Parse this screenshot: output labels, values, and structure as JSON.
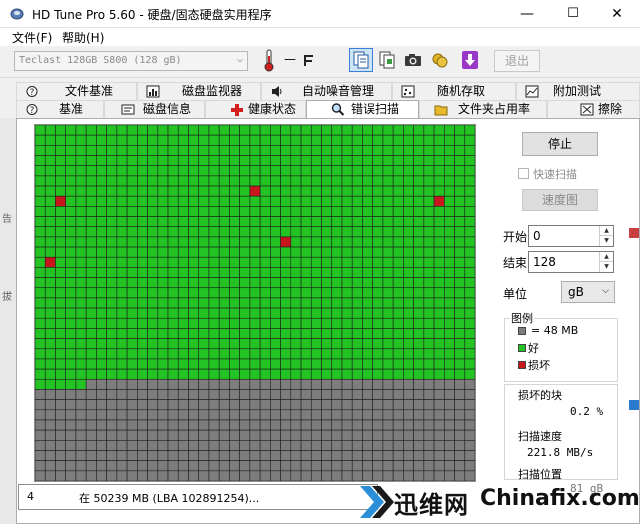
{
  "window": {
    "title": "HD Tune Pro 5.60 - 硬盘/固态硬盘实用程序",
    "controls": {
      "minimize": "—",
      "maximize": "☐",
      "close": "✕"
    }
  },
  "menu": {
    "file": "文件(F)",
    "help": "帮助(H)"
  },
  "toolbar": {
    "drive": "Teclast 128GB S800 (128 gB)",
    "temperature": "—",
    "exit_label": "退出"
  },
  "tabs_top": [
    {
      "label": "文件基准",
      "icon": "file-benchmark-icon"
    },
    {
      "label": "磁盘监视器",
      "icon": "disk-monitor-icon"
    },
    {
      "label": "自动噪音管理",
      "icon": "speaker-icon"
    },
    {
      "label": "随机存取",
      "icon": "random-access-icon"
    },
    {
      "label": "附加测试",
      "icon": "extra-tests-icon"
    }
  ],
  "tabs_bottom": [
    {
      "label": "基准",
      "icon": "benchmark-icon"
    },
    {
      "label": "磁盘信息",
      "icon": "disk-info-icon"
    },
    {
      "label": "健康状态",
      "icon": "health-cross-icon"
    },
    {
      "label": "错误扫描",
      "icon": "magnifier-icon",
      "active": true
    },
    {
      "label": "文件夹占用率",
      "icon": "folder-icon"
    },
    {
      "label": "擦除",
      "icon": "erase-icon"
    }
  ],
  "scan": {
    "cols": 43,
    "rows": 35,
    "scanned_blocks": 1080,
    "damaged_blocks": [
      [
        2,
        7
      ],
      [
        21,
        6
      ],
      [
        39,
        7
      ],
      [
        24,
        11
      ],
      [
        1,
        13
      ]
    ],
    "colors": {
      "good": "#22c322",
      "damaged": "#c8161d",
      "pending": "#7d7d7d",
      "grid_line": "#1e1e1e"
    }
  },
  "controls": {
    "stop_label": "停止",
    "quick_scan_label": "快速扫描",
    "quick_scan_checked": false,
    "speed_map_label": "速度图",
    "start_label": "开始",
    "start_value": "0",
    "end_label": "结束",
    "end_value": "128",
    "unit_label": "单位",
    "unit_value": "gB"
  },
  "legend": {
    "title": "图例",
    "block_size": "= 48 MB",
    "good": "好",
    "damaged": "损坏"
  },
  "stats": {
    "damaged_blocks_label": "损坏的块",
    "damaged_blocks_value": "0.2 %",
    "scan_speed_label": "扫描速度",
    "scan_speed_value": "221.8 MB/s",
    "scan_position_label": "扫描位置",
    "scan_position_value": "81 gB"
  },
  "status": {
    "count": "4",
    "message": "在 50239 MB (LBA 102891254)..."
  },
  "watermark": {
    "cn": "迅维网",
    "en": "Chinafix.com"
  },
  "edge_strip_text": [
    "告",
    "拔"
  ]
}
